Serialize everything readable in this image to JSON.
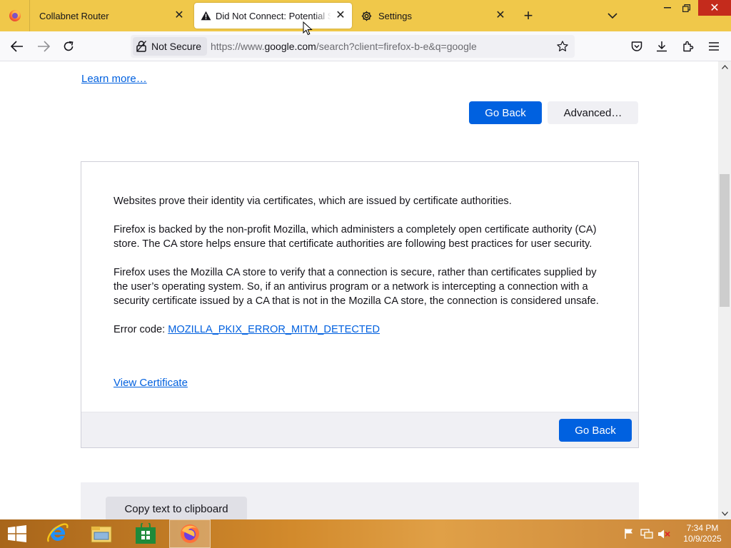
{
  "tabs": [
    {
      "label": "Collabnet Router",
      "active": false,
      "icon": "firefox-icon"
    },
    {
      "label": "Did Not Connect: Potential Security Issue",
      "active": true,
      "icon": "warning-icon"
    },
    {
      "label": "Settings",
      "active": false,
      "icon": "gear-icon"
    }
  ],
  "toolbar": {
    "security_label": "Not Secure",
    "url_prefix": "https://www.",
    "url_host": "google.com",
    "url_suffix": "/search?client=firefox-b-e&q=google"
  },
  "page": {
    "learn_more": "Learn more…",
    "go_back": "Go Back",
    "advanced": "Advanced…",
    "paragraphs": [
      "Websites prove their identity via certificates, which are issued by certificate authorities.",
      "Firefox is backed by the non-profit Mozilla, which administers a completely open certificate authority (CA) store. The CA store helps ensure that certificate authorities are following best practices for user security.",
      "Firefox uses the Mozilla CA store to verify that a connection is secure, rather than certificates supplied by the user’s operating system. So, if an antivirus program or a network is intercepting a connection with a security certificate issued by a CA that is not in the Mozilla CA store, the connection is considered unsafe."
    ],
    "error_code_label": "Error code: ",
    "error_code": "MOZILLA_PKIX_ERROR_MITM_DETECTED",
    "view_certificate": "View Certificate",
    "go_back_bottom": "Go Back",
    "copy_text": "Copy text to clipboard"
  },
  "taskbar": {
    "apps": [
      "internet-explorer",
      "file-explorer",
      "store",
      "firefox"
    ],
    "clock_time": "7:34 PM",
    "clock_date": "10/9/2025"
  },
  "colors": {
    "tabbar": "#f0c84a",
    "primary_button": "#0061e0",
    "link": "#0060df",
    "close_red": "#c42b1c"
  }
}
